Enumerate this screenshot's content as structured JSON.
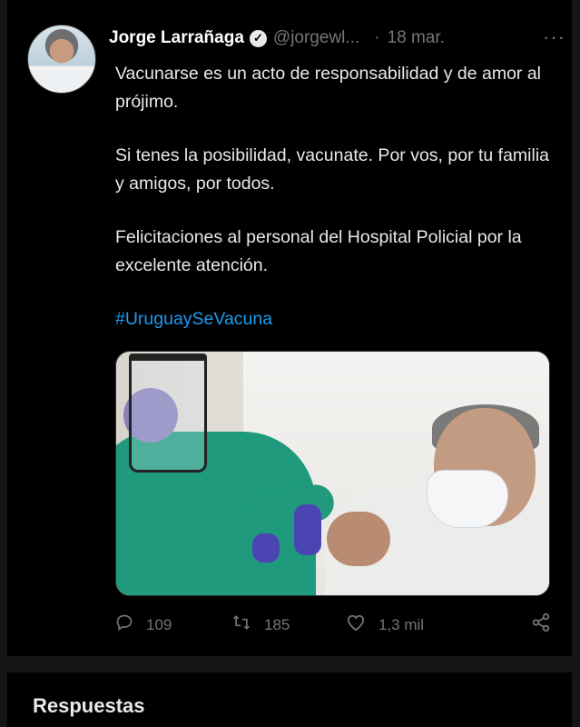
{
  "tweet": {
    "author_name": "Jorge Larrañaga",
    "handle": "@jorgewl...",
    "date": "18 mar.",
    "separator": "·",
    "more_label": "···",
    "verified_mark": "✓",
    "paragraphs": [
      "Vacunarse es un acto de responsabilidad y de amor al prójimo.",
      "Si tenes la posibilidad, vacunate. Por vos, por tu familia y amigos, por todos.",
      "Felicitaciones al personal del Hospital Policial por la excelente atención."
    ],
    "hashtag": "#UruguaySeVacuna",
    "stats": {
      "replies": "109",
      "retweets": "185",
      "likes": "1,3 mil"
    },
    "icons": {
      "reply": "reply-icon",
      "retweet": "retweet-icon",
      "like": "heart-icon",
      "share": "share-icon",
      "verified": "verified-badge-icon",
      "more": "more-options-icon"
    }
  },
  "section": {
    "replies_title": "Respuestas"
  },
  "colors": {
    "background": "#000000",
    "text": "#e7e9ea",
    "secondary": "#71767b",
    "link": "#1d9bf0"
  }
}
